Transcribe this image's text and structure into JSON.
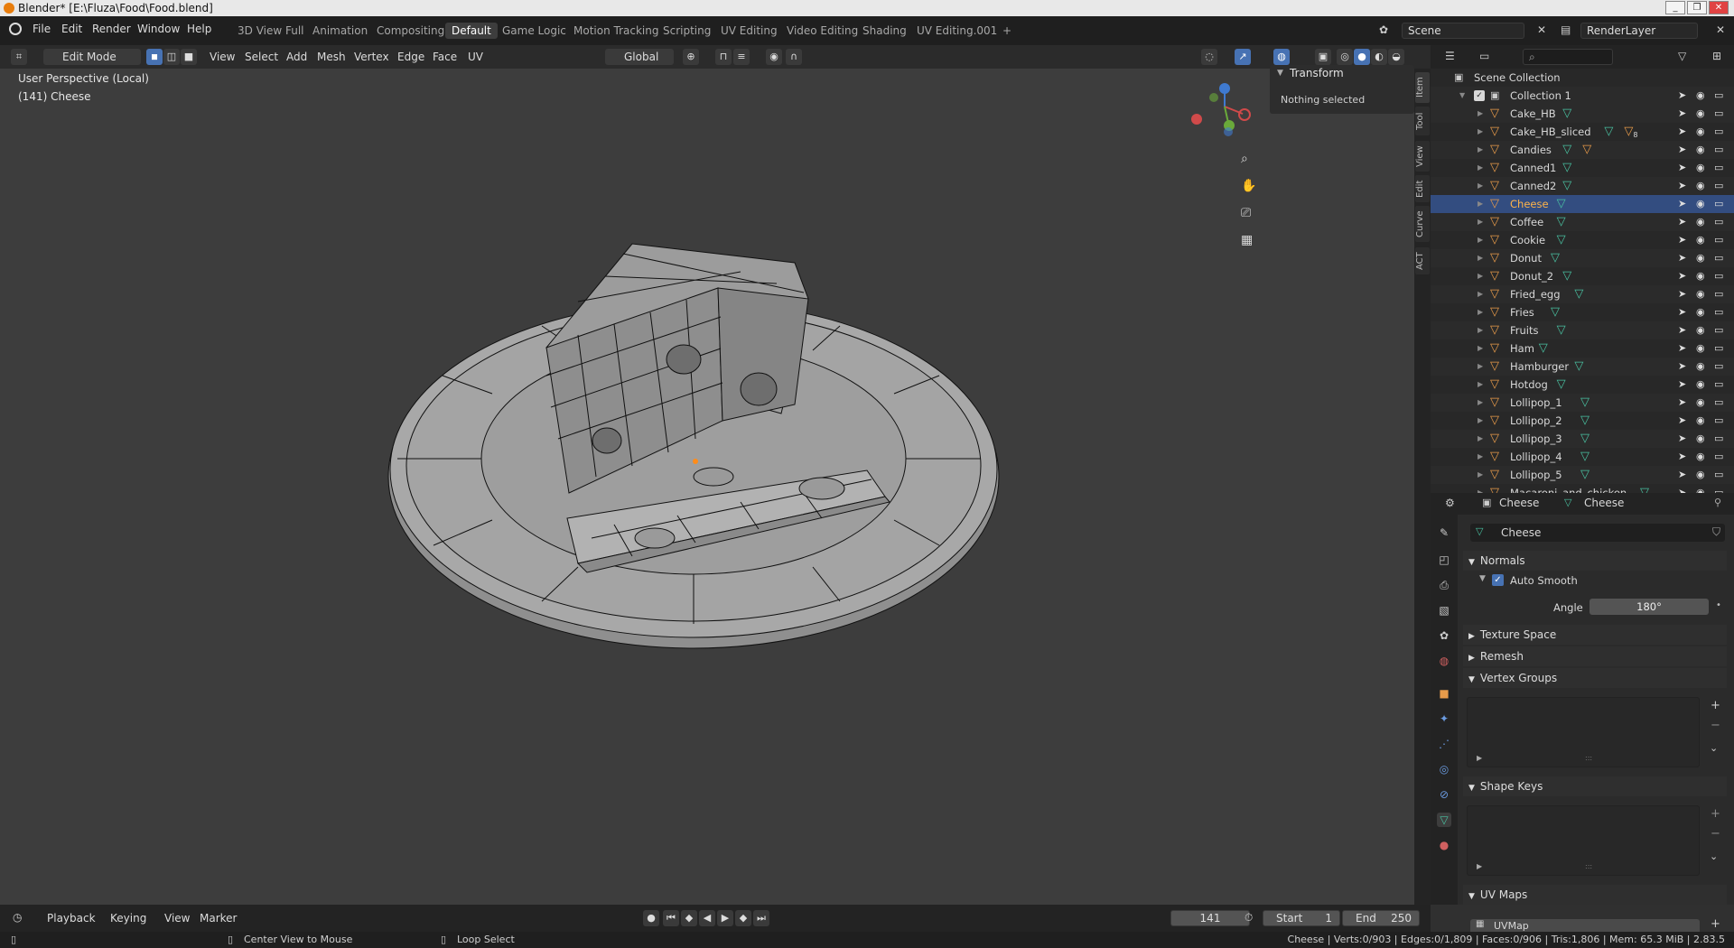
{
  "window": {
    "title": "Blender* [E:\\Fluza\\Food\\Food.blend]",
    "controls": [
      "_",
      "❐",
      "✕"
    ]
  },
  "menus": [
    "File",
    "Edit",
    "Render",
    "Window",
    "Help"
  ],
  "workspaces": [
    "3D View Full",
    "Animation",
    "Compositing",
    "Default",
    "Game Logic",
    "Motion Tracking",
    "Scripting",
    "UV Editing",
    "Video Editing",
    "Shading",
    "UV Editing.001",
    "+"
  ],
  "active_workspace": "Default",
  "scene": {
    "name": "Scene",
    "layer": "RenderLayer"
  },
  "viewport_header": {
    "mode": "Edit Mode",
    "menus": [
      "View",
      "Select",
      "Add",
      "Mesh",
      "Vertex",
      "Edge",
      "Face",
      "UV"
    ],
    "orientation": "Global"
  },
  "viewport": {
    "perspective": "User Perspective (Local)",
    "object_info": "(141) Cheese",
    "gizmo": {
      "x": "X",
      "y": "Y",
      "z": "Z"
    }
  },
  "npanel": {
    "section": "Transform",
    "content": "Nothing selected",
    "tabs": [
      "Item",
      "Tool",
      "View",
      "Edit",
      "Curve",
      "ACT"
    ]
  },
  "outliner": {
    "root": "Scene Collection",
    "collection": "Collection 1",
    "items": [
      "Cake_HB",
      "Cake_HB_sliced",
      "Candies",
      "Canned1",
      "Canned2",
      "Cheese",
      "Coffee",
      "Cookie",
      "Donut",
      "Donut_2",
      "Fried_egg",
      "Fries",
      "Fruits",
      "Ham",
      "Hamburger",
      "Hotdog",
      "Lollipop_1",
      "Lollipop_2",
      "Lollipop_3",
      "Lollipop_4",
      "Lollipop_5",
      "Macaroni_and_chicken"
    ],
    "selected": "Cheese",
    "badge": "8"
  },
  "properties": {
    "object": "Cheese",
    "mesh": "Cheese",
    "data_name": "Cheese",
    "sections": {
      "normals": "Normals",
      "auto_smooth": "Auto Smooth",
      "angle_label": "Angle",
      "angle_value": "180°",
      "texture_space": "Texture Space",
      "remesh": "Remesh",
      "vertex_groups": "Vertex Groups",
      "shape_keys": "Shape Keys",
      "uv_maps": "UV Maps",
      "uv_map": "UVMap"
    },
    "auto_smooth_checked": true
  },
  "timeline": {
    "menus": [
      "Playback",
      "Keying",
      "View",
      "Marker"
    ],
    "current_frame": "141",
    "start_label": "Start",
    "start": "1",
    "end_label": "End",
    "end": "250"
  },
  "status": {
    "hint1": "Center View to Mouse",
    "hint2": "Loop Select",
    "stats": "Cheese | Verts:0/903 | Edges:0/1,809 | Faces:0/906 | Tris:1,806 | Mem: 65.3 MiB | 2.83.5"
  },
  "colors": {
    "accent": "#4772b3",
    "selected_row": "#334d80",
    "object_orange": "#e89b4a",
    "data_green": "#49c0a0"
  }
}
